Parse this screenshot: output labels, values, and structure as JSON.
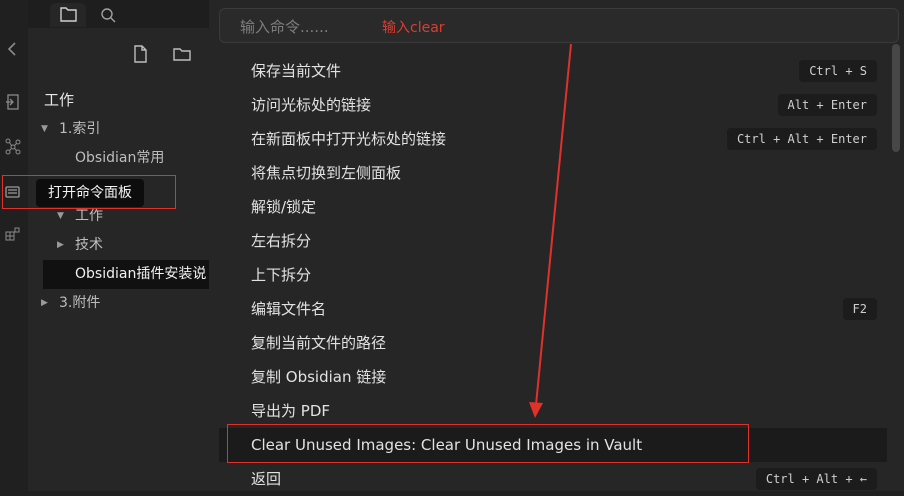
{
  "ribbon": {
    "icons": [
      "collapse-icon",
      "open-another-file-icon",
      "graph-view-icon",
      "command-palette-icon",
      "canvas-icon"
    ]
  },
  "sidebar": {
    "tabs": [
      "files-icon",
      "search-icon"
    ],
    "actions": [
      "new-note-icon",
      "new-folder-icon"
    ],
    "tree": [
      {
        "label": "工作"
      },
      {
        "label": "1.索引"
      },
      {
        "label": "Obsidian常用"
      },
      {
        "label": "工作"
      },
      {
        "label": "技术"
      },
      {
        "label": "Obsidian插件安装说"
      },
      {
        "label": "3.附件"
      }
    ],
    "tooltip": "打开命令面板"
  },
  "palette": {
    "placeholder": "输入命令......",
    "annotation": "输入clear",
    "commands": [
      {
        "label": "保存当前文件",
        "key": "Ctrl + S"
      },
      {
        "label": "访问光标处的链接",
        "key": "Alt + Enter"
      },
      {
        "label": "在新面板中打开光标处的链接",
        "key": "Ctrl + Alt + Enter"
      },
      {
        "label": "将焦点切换到左侧面板",
        "key": ""
      },
      {
        "label": "解锁/锁定",
        "key": ""
      },
      {
        "label": "左右拆分",
        "key": ""
      },
      {
        "label": "上下拆分",
        "key": ""
      },
      {
        "label": "编辑文件名",
        "key": "F2"
      },
      {
        "label": "复制当前文件的路径",
        "key": ""
      },
      {
        "label": "复制 Obsidian 链接",
        "key": ""
      },
      {
        "label": "导出为 PDF",
        "key": ""
      },
      {
        "label": "Clear Unused Images: Clear Unused Images in Vault",
        "key": ""
      },
      {
        "label": "返回",
        "key": "Ctrl + Alt + ←"
      }
    ]
  },
  "colors": {
    "background": "#262626",
    "annotation_red": "#e0312b",
    "highlight_row": "#1b1b1b"
  }
}
